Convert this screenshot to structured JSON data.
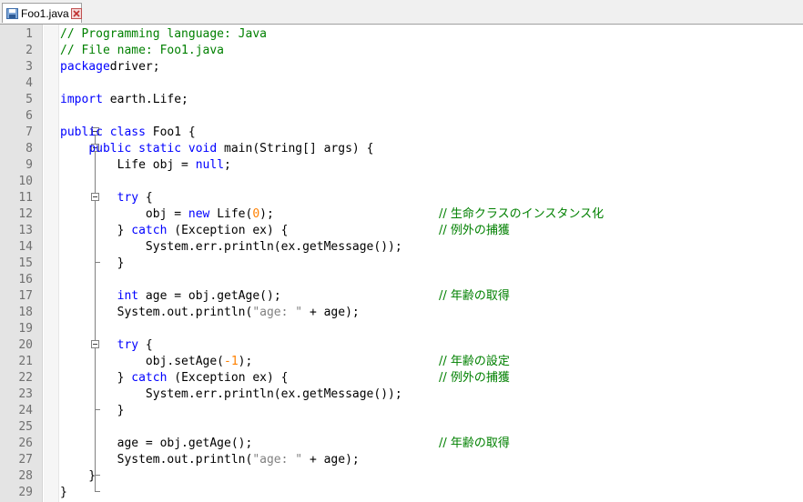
{
  "tab": {
    "title": "Foo1.java"
  },
  "editor": {
    "lines": [
      {
        "n": "1",
        "t": [
          [
            "c",
            "// Programming language: Java"
          ]
        ]
      },
      {
        "n": "2",
        "t": [
          [
            "c",
            "// File name: Foo1.java"
          ]
        ]
      },
      {
        "n": "3",
        "t": [
          [
            "k",
            "package"
          ],
          [
            "",
            "driver;"
          ]
        ]
      },
      {
        "n": "4",
        "t": []
      },
      {
        "n": "5",
        "t": [
          [
            "k",
            "import"
          ],
          [
            "",
            " earth.Life;"
          ]
        ]
      },
      {
        "n": "6",
        "t": []
      },
      {
        "n": "7",
        "t": [
          [
            "k",
            "public class"
          ],
          [
            "",
            " Foo1 {"
          ]
        ]
      },
      {
        "n": "8",
        "t": [
          [
            "",
            "    "
          ],
          [
            "k",
            "public static void"
          ],
          [
            "",
            " main(String[] args) {"
          ]
        ]
      },
      {
        "n": "9",
        "t": [
          [
            "",
            "        Life obj = "
          ],
          [
            "k",
            "null"
          ],
          [
            "",
            ";"
          ]
        ]
      },
      {
        "n": "10",
        "t": []
      },
      {
        "n": "11",
        "t": [
          [
            "",
            "        "
          ],
          [
            "k",
            "try"
          ],
          [
            "",
            " {"
          ]
        ]
      },
      {
        "n": "12",
        "t": [
          [
            "",
            "            obj = "
          ],
          [
            "k",
            "new"
          ],
          [
            "",
            " Life("
          ],
          [
            "n",
            "0"
          ],
          [
            "",
            ");"
          ]
        ],
        "jp": "// 生命クラスのインスタンス化"
      },
      {
        "n": "13",
        "t": [
          [
            "",
            "        } "
          ],
          [
            "k",
            "catch"
          ],
          [
            "",
            " (Exception ex) {"
          ]
        ],
        "jp": "// 例外の捕獲"
      },
      {
        "n": "14",
        "t": [
          [
            "",
            "            System.err.println(ex.getMessage());"
          ]
        ]
      },
      {
        "n": "15",
        "t": [
          [
            "",
            "        }"
          ]
        ]
      },
      {
        "n": "16",
        "t": []
      },
      {
        "n": "17",
        "t": [
          [
            "",
            "        "
          ],
          [
            "k",
            "int"
          ],
          [
            "",
            " age = obj.getAge();"
          ]
        ],
        "jp": "// 年齢の取得"
      },
      {
        "n": "18",
        "t": [
          [
            "",
            "        System.out.println("
          ],
          [
            "s",
            "\"age: \""
          ],
          [
            "",
            " + age);"
          ]
        ]
      },
      {
        "n": "19",
        "t": []
      },
      {
        "n": "20",
        "t": [
          [
            "",
            "        "
          ],
          [
            "k",
            "try"
          ],
          [
            "",
            " {"
          ]
        ]
      },
      {
        "n": "21",
        "t": [
          [
            "",
            "            obj.setAge("
          ],
          [
            "n",
            "-1"
          ],
          [
            "",
            ");"
          ]
        ],
        "jp": "// 年齢の設定"
      },
      {
        "n": "22",
        "t": [
          [
            "",
            "        } "
          ],
          [
            "k",
            "catch"
          ],
          [
            "",
            " (Exception ex) {"
          ]
        ],
        "jp": "// 例外の捕獲"
      },
      {
        "n": "23",
        "t": [
          [
            "",
            "            System.err.println(ex.getMessage());"
          ]
        ]
      },
      {
        "n": "24",
        "t": [
          [
            "",
            "        }"
          ]
        ]
      },
      {
        "n": "25",
        "t": []
      },
      {
        "n": "26",
        "t": [
          [
            "",
            "        age = obj.getAge();"
          ]
        ],
        "jp": "// 年齢の取得"
      },
      {
        "n": "27",
        "t": [
          [
            "",
            "        System.out.println("
          ],
          [
            "s",
            "\"age: \""
          ],
          [
            "",
            " + age);"
          ]
        ]
      },
      {
        "n": "28",
        "t": [
          [
            "",
            "    }"
          ]
        ]
      },
      {
        "n": "29",
        "t": [
          [
            "",
            "}"
          ]
        ]
      }
    ]
  },
  "colors": {
    "comment": "#008000",
    "keyword": "#0000ff",
    "number": "#ff8000",
    "string": "#808080",
    "default": "#000000"
  }
}
